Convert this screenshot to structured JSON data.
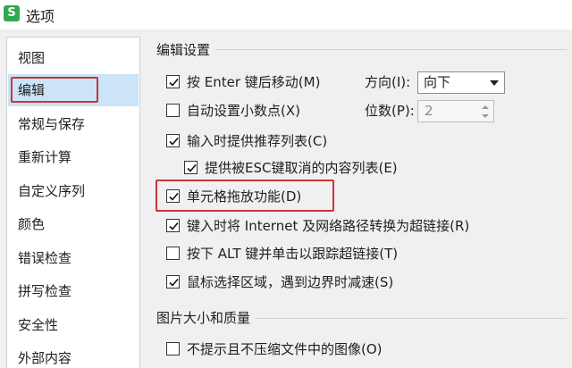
{
  "window": {
    "title": "选项",
    "app_icon_letter": "S"
  },
  "sidebar": {
    "items": [
      {
        "label": "视图"
      },
      {
        "label": "编辑"
      },
      {
        "label": "常规与保存"
      },
      {
        "label": "重新计算"
      },
      {
        "label": "自定义序列"
      },
      {
        "label": "颜色"
      },
      {
        "label": "错误检查"
      },
      {
        "label": "拼写检查"
      },
      {
        "label": "安全性"
      },
      {
        "label": "外部内容"
      }
    ],
    "selected_index": 1
  },
  "edit_settings": {
    "title": "编辑设置",
    "options": [
      {
        "label": "按 Enter 键后移动(M)",
        "checked": true
      },
      {
        "label": "自动设置小数点(X)",
        "checked": false
      },
      {
        "label": "输入时提供推荐列表(C)",
        "checked": true
      },
      {
        "label": "提供被ESC键取消的内容列表(E)",
        "checked": true
      },
      {
        "label": "单元格拖放功能(D)",
        "checked": true
      },
      {
        "label": "键入时将 Internet 及网络路径转换为超链接(R)",
        "checked": true
      },
      {
        "label": "按下 ALT 键并单击以跟踪超链接(T)",
        "checked": false
      },
      {
        "label": "鼠标选择区域，遇到边界时减速(S)",
        "checked": true
      }
    ],
    "direction": {
      "label": "方向(I):",
      "value": "向下"
    },
    "places": {
      "label": "位数(P):",
      "value": "2"
    }
  },
  "image_quality": {
    "title": "图片大小和质量",
    "options": [
      {
        "label": "不提示且不压缩文件中的图像(O)",
        "checked": false
      }
    ]
  },
  "colors": {
    "accent_selected": "#cce4f7",
    "highlight_red": "#c9343a",
    "app_green": "#2fa84f"
  },
  "icons": [
    "app-icon",
    "checkbox-check-icon",
    "dropdown-arrow-icon",
    "spin-up-icon",
    "spin-down-icon"
  ]
}
